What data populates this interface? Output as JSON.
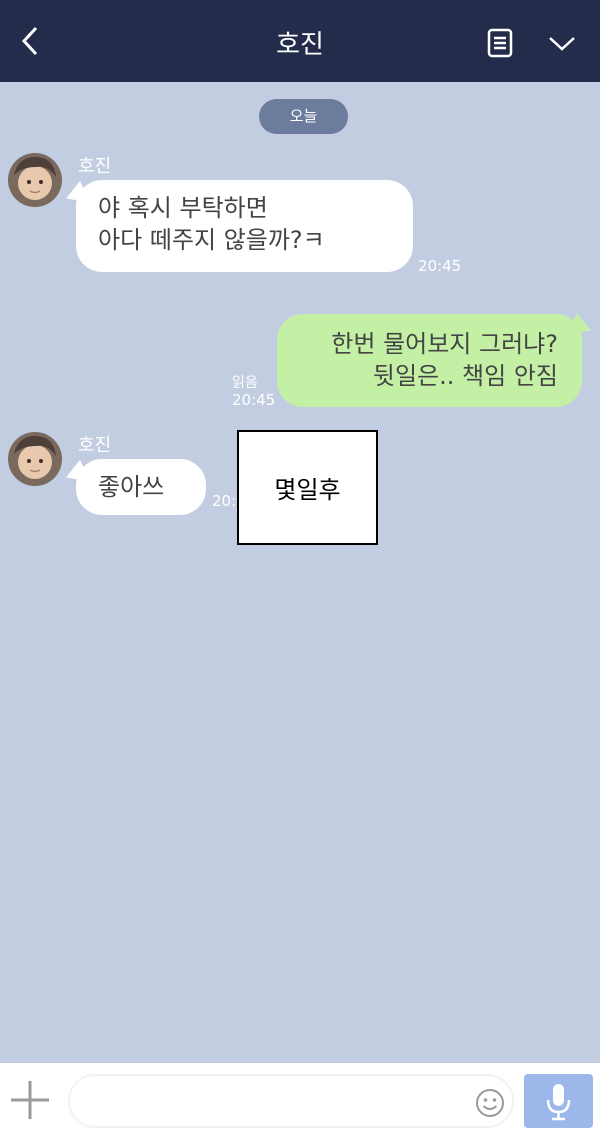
{
  "header": {
    "title": "호진",
    "back_icon": "chevron-left-icon",
    "notes_icon": "notes-icon",
    "menu_icon": "chevron-down-icon"
  },
  "date_label": "오늘",
  "messages": [
    {
      "sender": "호진",
      "direction": "in",
      "lines": [
        "야 혹시 부탁하면",
        "아다 떼주지 않을까?ㅋ"
      ],
      "time": "20:45"
    },
    {
      "direction": "out",
      "lines": [
        "한번 물어보지 그러냐?",
        "뒷일은.. 책임 안짐"
      ],
      "read": "읽음",
      "time": "20:45"
    },
    {
      "sender": "호진",
      "direction": "in",
      "lines": [
        "좋아쓰"
      ],
      "time": "20:"
    }
  ],
  "caption": "몇일후",
  "composer": {
    "placeholder": "",
    "value": "",
    "plus_icon": "plus-icon",
    "emoji_icon": "emoji-icon",
    "mic_icon": "microphone-icon"
  }
}
